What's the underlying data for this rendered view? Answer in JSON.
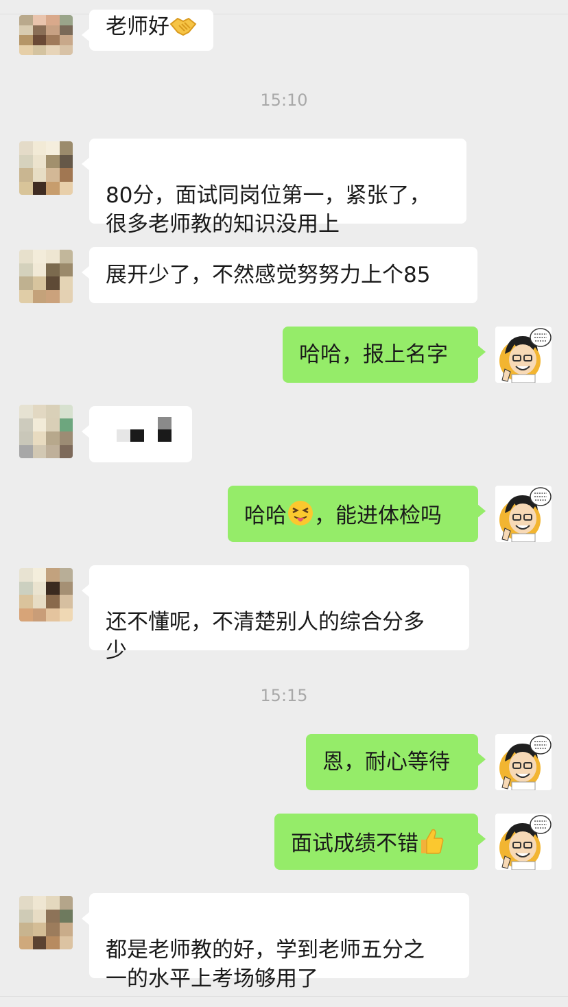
{
  "timestamps": [
    "15:10",
    "15:15"
  ],
  "messages": [
    {
      "side": "left",
      "text": "老师好",
      "emoji": "handshake-emoji"
    },
    {
      "side": "left",
      "text": "80分，面试同岗位第一，紧张了，\n很多老师教的知识没用上"
    },
    {
      "side": "left",
      "text": "展开少了，不然感觉努努力上个85"
    },
    {
      "side": "right",
      "text": "哈哈，报上名字"
    },
    {
      "side": "left",
      "text": "",
      "redacted": true
    },
    {
      "side": "right",
      "text_before": "哈哈",
      "emoji": "squinting-tongue-emoji",
      "text_after": "，能进体检吗"
    },
    {
      "side": "left",
      "text": "还不懂呢，不清楚别人的综合分多\n少"
    },
    {
      "side": "right",
      "text": "恩，耐心等待"
    },
    {
      "side": "right",
      "text": "面试成绩不错",
      "emoji": "thumbs-up-emoji"
    },
    {
      "side": "left",
      "text": "都是老师教的好，学到老师五分之\n一的水平上考场够用了"
    }
  ],
  "colors": {
    "background": "#ededed",
    "bubble_left": "#ffffff",
    "bubble_right": "#95ec69",
    "timestamp": "#a8a8a8"
  },
  "avatar_mosaic": {
    "a1": [
      "#b9a98c",
      "#e9c4ad",
      "#d9a98b",
      "#9aa58a",
      "#d8cbb0",
      "#8a6e56",
      "#c7a183",
      "#7a6a58",
      "#b59567",
      "#6b4a36",
      "#a07a5a",
      "#c8a88a",
      "#e6cfa8",
      "#d4c3a0",
      "#e7d4b8",
      "#d8c2a6"
    ],
    "a2": [
      "#e4dbc8",
      "#f2ead6",
      "#f5eedd",
      "#9b8b6c",
      "#d6d2bd",
      "#ece3cd",
      "#a2906d",
      "#655848",
      "#c9b691",
      "#e7ddc4",
      "#d3b896",
      "#a17752",
      "#d8c499",
      "#3f2c22",
      "#c79d6d",
      "#e8cfaa"
    ],
    "a3": [
      "#e7e0cc",
      "#f3ecda",
      "#eee6d2",
      "#c2b79b",
      "#d4d1bc",
      "#f1e9d6",
      "#7b6a4e",
      "#9b8a6b",
      "#bfb190",
      "#d7c49e",
      "#5e4a36",
      "#e4d4b5",
      "#e0cda7",
      "#c4a27a",
      "#cba27c",
      "#e4d1b3"
    ],
    "a4": [
      "#e6e2d2",
      "#e2d8c2",
      "#d9d0b8",
      "#d7e1cf",
      "#cdcbbd",
      "#f2ebd8",
      "#d9cfb7",
      "#6da67e",
      "#c9c7b9",
      "#e8dbc0",
      "#b7a88c",
      "#9c8c74",
      "#a7a7a7",
      "#d2c8b3",
      "#bfb09a",
      "#7d6a5a"
    ],
    "a5": [
      "#e8e3d2",
      "#f4eedc",
      "#c2a27e",
      "#b8ae97",
      "#ccd0c0",
      "#eae3cf",
      "#3b2a1f",
      "#a59074",
      "#dac39c",
      "#e7dcc4",
      "#8a6a4c",
      "#d6bfa0",
      "#d7a478",
      "#c99d78",
      "#e4c49e",
      "#efd8b4"
    ],
    "a6": [
      "#e2dac6",
      "#efe6d2",
      "#e4d8be",
      "#b4a58a",
      "#cfcbb6",
      "#e7dcc4",
      "#8d7358",
      "#6e7a5e",
      "#c8b48f",
      "#d4bd96",
      "#9c7c5c",
      "#c9ac8a",
      "#cfa97c",
      "#5b4231",
      "#b78b60",
      "#dcc3a2"
    ]
  }
}
